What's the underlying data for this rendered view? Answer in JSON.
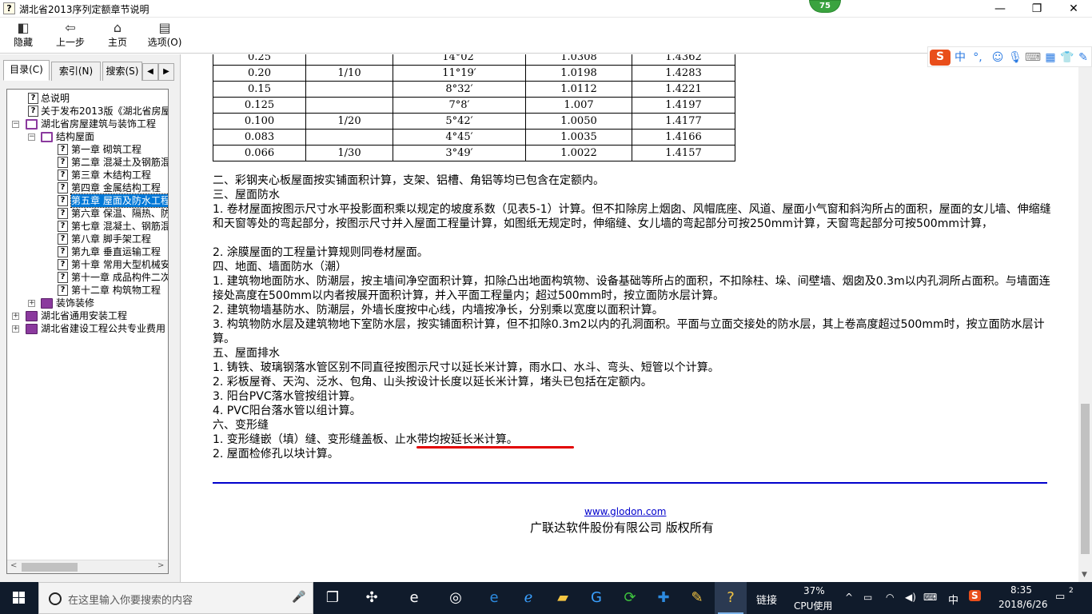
{
  "window": {
    "title": "湖北省2013序列定额章节说明",
    "badge": "75",
    "controls": {
      "minimize": "—",
      "maximize": "❐",
      "close": "✕"
    }
  },
  "toolbar": {
    "hide": "隐藏",
    "back": "上一步",
    "home": "主页",
    "options": "选项(O)"
  },
  "tabs": {
    "contents": "目录(C)",
    "index": "索引(N)",
    "search": "搜索(S)",
    "prev": "◀",
    "next": "▶"
  },
  "tree": [
    {
      "label": "总说明"
    },
    {
      "label": "关于发布2013版《湖北省房屋"
    },
    {
      "label": "湖北省房屋建筑与装饰工程",
      "expander": "−"
    },
    {
      "label": "结构屋面",
      "expander": "−"
    },
    {
      "label": "第一章 砌筑工程"
    },
    {
      "label": "第二章 混凝土及钢筋混"
    },
    {
      "label": "第三章 木结构工程"
    },
    {
      "label": "第四章 金属结构工程"
    },
    {
      "label": "第五章 屋面及防水工程"
    },
    {
      "label": "第六章 保温、隔热、防"
    },
    {
      "label": "第七章 混凝土、钢筋混"
    },
    {
      "label": "第八章 脚手架工程"
    },
    {
      "label": "第九章 垂直运输工程"
    },
    {
      "label": "第十章 常用大型机械安"
    },
    {
      "label": "第十一章 成品构件二次"
    },
    {
      "label": "第十二章 构筑物工程"
    },
    {
      "label": "装饰装修",
      "expander": "+"
    },
    {
      "label": "湖北省通用安装工程",
      "expander": "+"
    },
    {
      "label": "湖北省建设工程公共专业费用",
      "expander": "+"
    }
  ],
  "table_rows": [
    [
      "0.25",
      "",
      "14°02′",
      "1.0308",
      "1.4362"
    ],
    [
      "0.20",
      "1/10",
      "11°19′",
      "1.0198",
      "1.4283"
    ],
    [
      "0.15",
      "",
      "8°32′",
      "1.0112",
      "1.4221"
    ],
    [
      "0.125",
      "",
      "7°8′",
      "1.007",
      "1.4197"
    ],
    [
      "0.100",
      "1/20",
      "5°42′",
      "1.0050",
      "1.4177"
    ],
    [
      "0.083",
      "",
      "4°45′",
      "1.0035",
      "1.4166"
    ],
    [
      "0.066",
      "1/30",
      "3°49′",
      "1.0022",
      "1.4157"
    ]
  ],
  "body": [
    "二、彩钢夹心板屋面按实铺面积计算，支架、铝槽、角铝等均已包含在定额内。",
    "三、屋面防水",
    "1. 卷材屋面按图示尺寸水平投影面积乘以规定的坡度系数（见表5-1）计算。但不扣除房上烟囱、风帽底座、风道、屋面小气窗和斜沟所占的面积，屋面的女儿墙、伸缩缝和天窗等处的弯起部分，按图示尺寸并入屋面工程量计算，如图纸无规定时，伸缩缝、女儿墙的弯起部分可按250mm计算，天窗弯起部分可按500mm计算，",
    "2. 涂膜屋面的工程量计算规则同卷材屋面。",
    "四、地面、墙面防水（潮）",
    "1. 建筑物地面防水、防潮层，按主墙间净空面积计算，扣除凸出地面构筑物、设备基础等所占的面积，不扣除柱、垛、间壁墙、烟囱及0.3m以内孔洞所占面积。与墙面连接处高度在500mm以内者按展开面积计算，并入平面工程量内；超过500mm时，按立面防水层计算。",
    "2. 建筑物墙基防水、防潮层，外墙长度按中心线，内墙按净长，分别乘以宽度以面积计算。",
    "3. 构筑物防水层及建筑物地下室防水层，按实铺面积计算，但不扣除0.3m2以内的孔洞面积。平面与立面交接处的防水层，其上卷高度超过500mm时，按立面防水层计算。",
    "五、屋面排水",
    "1. 铸铁、玻璃钢落水管区别不同直径按图示尺寸以延长米计算，雨水口、水斗、弯头、短管以个计算。",
    "2. 彩板屋脊、天沟、泛水、包角、山头按设计长度以延长米计算，堵头已包括在定额内。",
    "3. 阳台PVC落水管按组计算。",
    "4. PVC阳台落水管以组计算。",
    "六、变形缝",
    "1. 变形缝嵌（填）缝、变形缝盖板、止水带均按延长米计算。",
    "2. 屋面检修孔以块计算。"
  ],
  "footer": {
    "link": "www.glodon.com",
    "copyright": "广联达软件股份有限公司 版权所有"
  },
  "ime": {
    "lang": "中",
    "punct": "°,"
  },
  "taskbar": {
    "search_placeholder": "在这里输入你要搜索的内容",
    "link": "链接",
    "cpu_percent": "37%",
    "cpu_label": "CPU使用",
    "ime_lang": "中",
    "time": "8:35",
    "date": "2018/6/26",
    "notifications": "2"
  },
  "colors": {
    "selection": "#0078d7",
    "rule": "#0000cc",
    "annotation": "#e20000",
    "taskbar": "#101b2b"
  }
}
